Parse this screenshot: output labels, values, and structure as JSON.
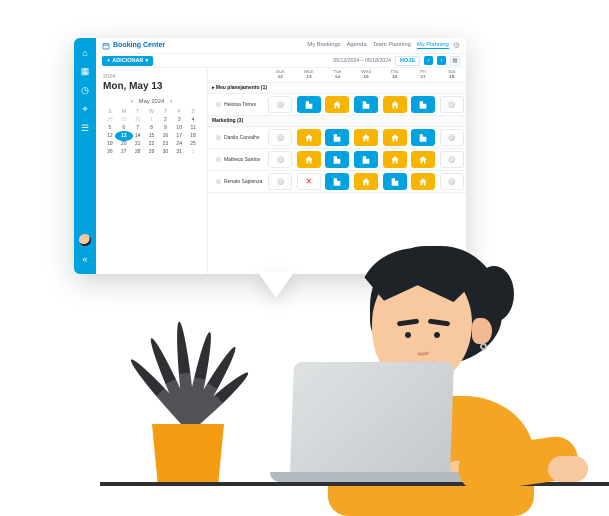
{
  "app": {
    "title": "Booking Center",
    "nav": {
      "my_bookings": "My Bookings",
      "agenda": "Agenda",
      "team_planning": "Team Planning",
      "my_planning": "My Planning"
    }
  },
  "subbar": {
    "add_label": "ADICIONAR",
    "date_range": "05/12/2024 – 05/18/2024",
    "today_label": "HOJE"
  },
  "calendar": {
    "year": "2024",
    "heading": "Mon, May 13",
    "month_label": "May 2024",
    "dow": [
      "S",
      "M",
      "T",
      "W",
      "T",
      "F",
      "S"
    ],
    "weeks": [
      [
        "28",
        "29",
        "30",
        "1",
        "2",
        "3",
        "4"
      ],
      [
        "5",
        "6",
        "7",
        "8",
        "9",
        "10",
        "11"
      ],
      [
        "12",
        "13",
        "14",
        "15",
        "16",
        "17",
        "18"
      ],
      [
        "19",
        "20",
        "21",
        "22",
        "23",
        "24",
        "25"
      ],
      [
        "26",
        "27",
        "28",
        "29",
        "30",
        "31",
        "1"
      ]
    ],
    "selected": "13",
    "dim": [
      "28",
      "29",
      "30",
      "1"
    ]
  },
  "plan": {
    "head": [
      {
        "dow": "",
        "num": ""
      },
      {
        "dow": "Sun",
        "num": "12"
      },
      {
        "dow": "Mon",
        "num": "13"
      },
      {
        "dow": "Tue",
        "num": "14"
      },
      {
        "dow": "Wed",
        "num": "15"
      },
      {
        "dow": "Thu",
        "num": "16"
      },
      {
        "dow": "Fri",
        "num": "17"
      },
      {
        "dow": "Sat",
        "num": "18"
      }
    ],
    "groups": [
      {
        "label": "▸ Meu planejamento (1)",
        "rows": [
          {
            "name": "Heloísa Torres",
            "cells": [
              "blank",
              "office",
              "home",
              "office",
              "home",
              "office",
              "blank"
            ]
          }
        ]
      },
      {
        "label": "Marketing (3)",
        "rows": [
          {
            "name": "Danilo Carvalho",
            "cells": [
              "blank",
              "home",
              "office",
              "home",
              "home",
              "office",
              "blank"
            ]
          },
          {
            "name": "Matheus Santos",
            "cells": [
              "blank",
              "home",
              "office",
              "office",
              "home",
              "home",
              "blank"
            ]
          },
          {
            "name": "Renato Sapienza",
            "cells": [
              "blank",
              "off",
              "office",
              "home",
              "office",
              "home",
              "blank"
            ]
          }
        ]
      }
    ]
  }
}
